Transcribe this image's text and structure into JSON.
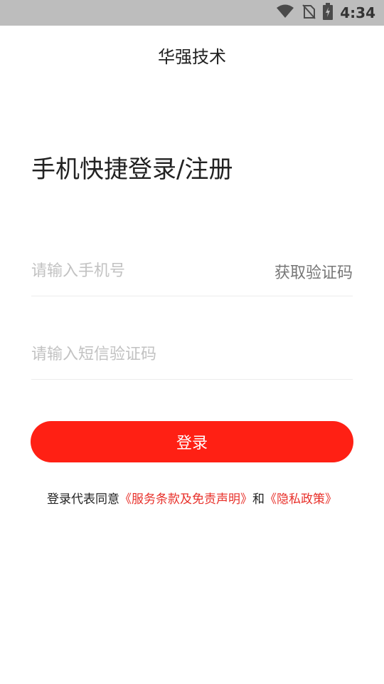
{
  "status_bar": {
    "time": "4:34",
    "icons": [
      "wifi-icon",
      "no-sim-icon",
      "battery-charging-icon"
    ]
  },
  "header": {
    "title": "华强技术"
  },
  "main": {
    "heading": "手机快捷登录/注册",
    "phone_field": {
      "placeholder": "请输入手机号",
      "value": ""
    },
    "get_code_label": "获取验证码",
    "code_field": {
      "placeholder": "请输入短信验证码",
      "value": ""
    },
    "login_label": "登录"
  },
  "agreement": {
    "prefix": "登录代表同意",
    "terms_link": "《服务条款及免责声明》",
    "conjunction": "和",
    "privacy_link": "《隐私政策》"
  },
  "colors": {
    "accent": "#ff2014",
    "link": "#e8302a",
    "status_bar": "#bdbdbd"
  }
}
